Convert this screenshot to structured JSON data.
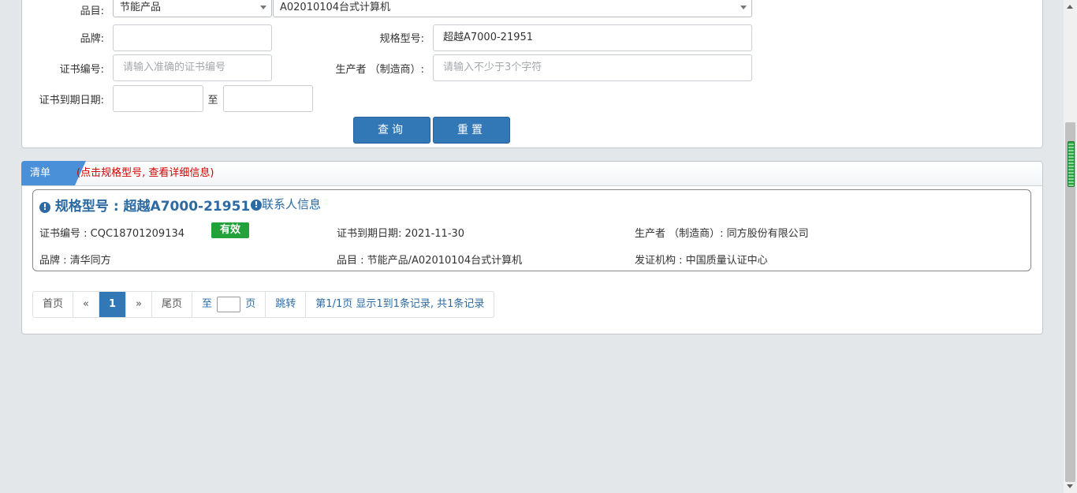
{
  "search": {
    "category_label": "品目:",
    "category_value": "节能产品",
    "subcategory_value": "A02010104台式计算机",
    "brand_label": "品牌:",
    "brand_value": "",
    "model_label": "规格型号:",
    "model_value": "超越A7000-21951",
    "cert_no_label": "证书编号:",
    "cert_no_placeholder": "请输入准确的证书编号",
    "manufacturer_label": "生产者 （制造商）:",
    "manufacturer_placeholder": "请输入不少于3个字符",
    "expiry_label": "证书到期日期:",
    "expiry_separator": "至",
    "query_button": "查询",
    "reset_button": "重置"
  },
  "list": {
    "tab_label": "清单",
    "hint": "(点击规格型号, 查看详细信息)",
    "items": [
      {
        "title": "规格型号 : 超越A7000-21951",
        "contact_link": "联系人信息",
        "cert_no": "证书编号 : CQC18701209134",
        "status": "有效",
        "expiry": "证书到期日期: 2021-11-30",
        "manufacturer": "生产者 （制造商）: 同方股份有限公司",
        "brand": "品牌 : 清华同方",
        "category": "品目 : 节能产品/A02010104台式计算机",
        "issuer": "发证机构 : 中国质量认证中心"
      }
    ]
  },
  "pagination": {
    "first": "首页",
    "prev": "«",
    "current": "1",
    "next": "»",
    "last": "尾页",
    "goto_prefix": "至",
    "goto_suffix": "页",
    "jump": "跳转",
    "summary": "第1/1页  显示1到1条记录, 共1条记录"
  },
  "icons": {
    "info": "info-circle-icon",
    "dropdown": "caret-down-icon"
  },
  "colors": {
    "primary_button": "#3277b6",
    "tab": "#4a90d9",
    "link": "#2b6aa3",
    "hint": "#d40000",
    "status_valid": "#23a13b"
  }
}
